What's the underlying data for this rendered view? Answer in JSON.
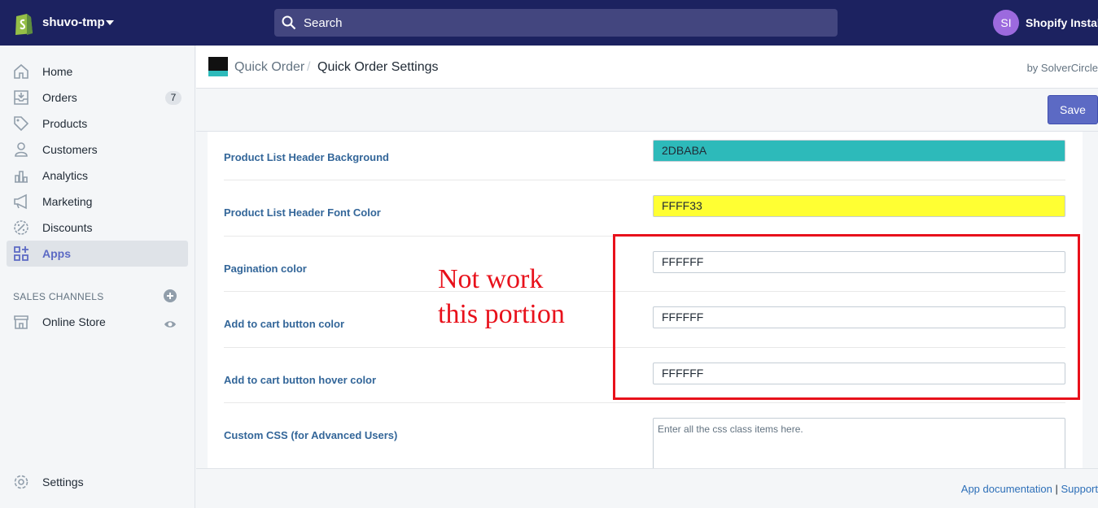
{
  "topbar": {
    "store_name": "shuvo-tmp",
    "search_placeholder": "Search",
    "avatar_initials": "SI",
    "user_name": "Shopify Install"
  },
  "sidebar": {
    "items": [
      {
        "label": "Home",
        "icon": "home-icon"
      },
      {
        "label": "Orders",
        "icon": "orders-icon",
        "badge": "7"
      },
      {
        "label": "Products",
        "icon": "tag-icon"
      },
      {
        "label": "Customers",
        "icon": "person-icon"
      },
      {
        "label": "Analytics",
        "icon": "bar-chart-icon"
      },
      {
        "label": "Marketing",
        "icon": "megaphone-icon"
      },
      {
        "label": "Discounts",
        "icon": "discount-icon"
      },
      {
        "label": "Apps",
        "icon": "apps-icon",
        "active": true
      }
    ],
    "sales_channels_title": "SALES CHANNELS",
    "channels": [
      {
        "label": "Online Store",
        "icon": "store-icon"
      }
    ],
    "settings_label": "Settings"
  },
  "header": {
    "breadcrumb_app": "Quick Order",
    "breadcrumb_sep": "/",
    "page_title": "Quick Order Settings",
    "by_text": "by SolverCircle",
    "save_label": "Save"
  },
  "settings": {
    "rows": [
      {
        "label": "Product List Header Background",
        "value": "2DBABA",
        "color": "#2dbaba"
      },
      {
        "label": "Product List Header Font Color",
        "value": "FFFF33",
        "color": "#ffff33"
      },
      {
        "label": "Pagination color",
        "value": "FFFFFF",
        "color": "#ffffff"
      },
      {
        "label": "Add to cart button color",
        "value": "FFFFFF",
        "color": "#ffffff"
      },
      {
        "label": "Add to cart button hover color",
        "value": "FFFFFF",
        "color": "#ffffff"
      }
    ],
    "custom_css_label": "Custom CSS (for Advanced Users)",
    "custom_css_placeholder": "Enter all the css class items here."
  },
  "footer": {
    "doc_link": "App documentation",
    "sep": "|",
    "support_link": "Support"
  },
  "annotation": {
    "line1": "Not work",
    "line2": "this portion",
    "color": "#e8111b"
  }
}
